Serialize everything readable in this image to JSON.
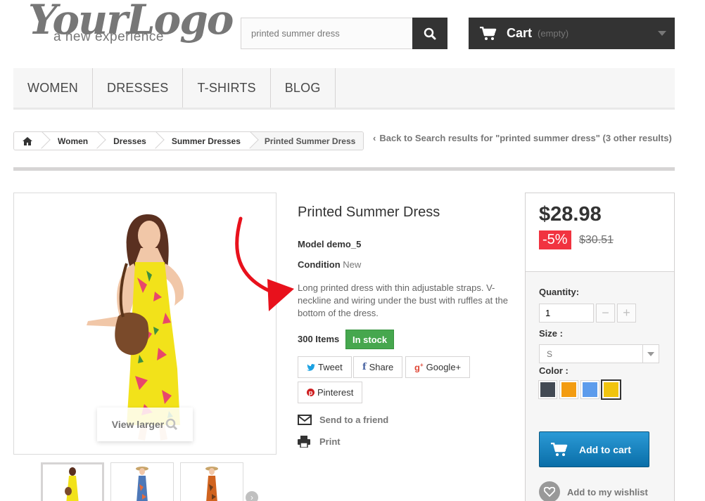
{
  "logo": {
    "main": "YourLogo",
    "tagline": "a new experience"
  },
  "search": {
    "value": "printed summer dress"
  },
  "cart": {
    "label": "Cart",
    "status": "(empty)"
  },
  "menu": [
    {
      "label": "WOMEN"
    },
    {
      "label": "DRESSES"
    },
    {
      "label": "T-SHIRTS"
    },
    {
      "label": "BLOG"
    }
  ],
  "breadcrumb": {
    "items": [
      "Women",
      "Dresses",
      "Summer Dresses"
    ],
    "current": "Printed Summer Dress"
  },
  "back_link": "Back to Search results for \"printed summer dress\" (3 other results)",
  "image": {
    "view_larger": "View larger"
  },
  "product": {
    "title": "Printed Summer Dress",
    "model_label": "Model",
    "model_value": "demo_5",
    "condition_label": "Condition",
    "condition_value": "New",
    "description": "Long printed dress with thin adjustable straps. V-neckline and wiring under the bust with ruffles at the bottom of the dress.",
    "quantity_text": "300 Items",
    "stock_badge": "In stock"
  },
  "social": {
    "tweet": "Tweet",
    "share": "Share",
    "google": "Google+",
    "pinterest": "Pinterest"
  },
  "actions": {
    "send_friend": "Send to a friend",
    "print": "Print"
  },
  "buy_box": {
    "price": "$28.98",
    "discount": "-5%",
    "old_price": "$30.51",
    "quantity_label": "Quantity:",
    "quantity_value": "1",
    "size_label": "Size :",
    "size_value": "S",
    "color_label": "Color :",
    "colors": [
      "#434a54",
      "#f39c11",
      "#5d9cec",
      "#f1c40f"
    ],
    "selected_color_index": 3,
    "add_to_cart": "Add to cart",
    "wishlist": "Add to my wishlist"
  },
  "colors": {
    "accent_red": "#e8111c",
    "in_stock_green": "#46a74e",
    "cart_blue": "#0f7ec0",
    "discount_red": "#f13340"
  }
}
